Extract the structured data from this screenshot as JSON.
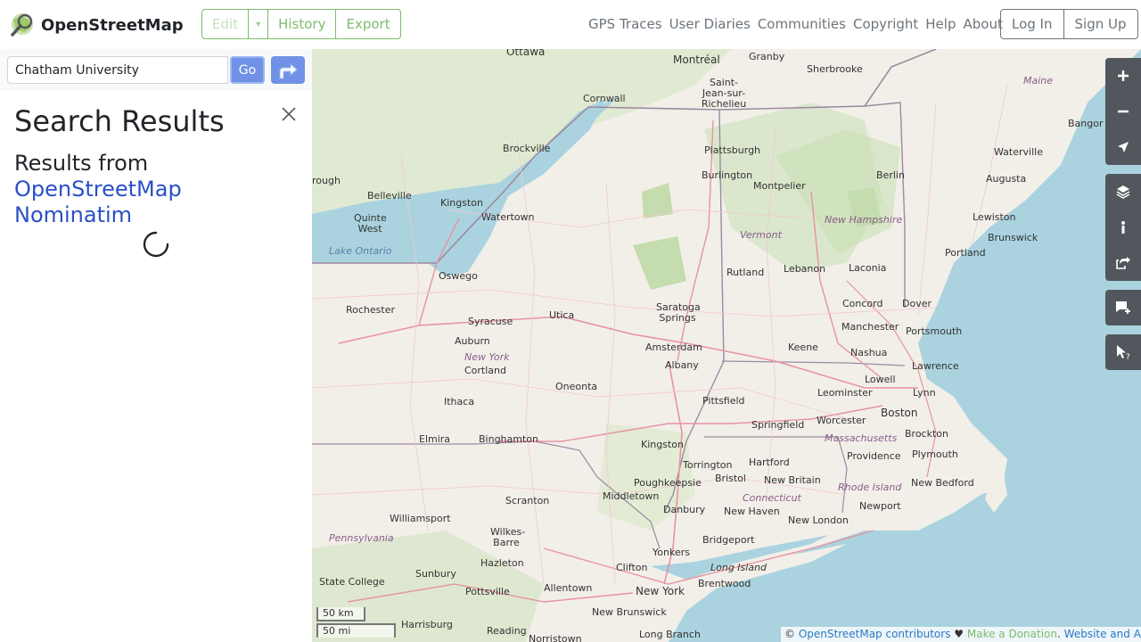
{
  "header": {
    "title": "OpenStreetMap",
    "edit": "Edit",
    "history": "History",
    "export": "Export",
    "nav": [
      "GPS Traces",
      "User Diaries",
      "Communities",
      "Copyright",
      "Help",
      "About"
    ],
    "login": "Log In",
    "signup": "Sign Up"
  },
  "search": {
    "value": "Chatham University",
    "go": "Go"
  },
  "results": {
    "title": "Search Results",
    "from": "Results from",
    "provider_line1": "OpenStreetMap",
    "provider_line2": "Nominatim"
  },
  "map": {
    "places": [
      {
        "name": "Ottawa"
      },
      {
        "name": "Montréal"
      },
      {
        "name": "Granby"
      },
      {
        "name": "Sherbrooke"
      },
      {
        "name": "Saint-Jean-sur-Richelieu"
      },
      {
        "name": "Cornwall"
      },
      {
        "name": "Maine"
      },
      {
        "name": "Bangor"
      },
      {
        "name": "Brockville"
      },
      {
        "name": "Plattsburgh"
      },
      {
        "name": "Waterville"
      },
      {
        "name": "rough"
      },
      {
        "name": "Burlington"
      },
      {
        "name": "Montpelier"
      },
      {
        "name": "Berlin"
      },
      {
        "name": "Augusta"
      },
      {
        "name": "Belleville"
      },
      {
        "name": "Kingston"
      },
      {
        "name": "Quinte West"
      },
      {
        "name": "Watertown"
      },
      {
        "name": "New Hampshire"
      },
      {
        "name": "Lewiston"
      },
      {
        "name": "Vermont"
      },
      {
        "name": "Brunswick"
      },
      {
        "name": "Lake Ontario"
      },
      {
        "name": "Portland"
      },
      {
        "name": "Oswego"
      },
      {
        "name": "Rutland"
      },
      {
        "name": "Lebanon"
      },
      {
        "name": "Laconia"
      },
      {
        "name": "Rochester"
      },
      {
        "name": "Saratoga Springs"
      },
      {
        "name": "Concord"
      },
      {
        "name": "Dover"
      },
      {
        "name": "Syracuse"
      },
      {
        "name": "Utica"
      },
      {
        "name": "Manchester"
      },
      {
        "name": "Portsmouth"
      },
      {
        "name": "Auburn"
      },
      {
        "name": "Amsterdam"
      },
      {
        "name": "Keene"
      },
      {
        "name": "Nashua"
      },
      {
        "name": "New York"
      },
      {
        "name": "Albany"
      },
      {
        "name": "Lawrence"
      },
      {
        "name": "Cortland"
      },
      {
        "name": "Lowell"
      },
      {
        "name": "Leominster"
      },
      {
        "name": "Lynn"
      },
      {
        "name": "Oneonta"
      },
      {
        "name": "Ithaca"
      },
      {
        "name": "Pittsfield"
      },
      {
        "name": "Boston"
      },
      {
        "name": "Worcester"
      },
      {
        "name": "Springfield"
      },
      {
        "name": "Elmira"
      },
      {
        "name": "Binghamton"
      },
      {
        "name": "Massachusetts"
      },
      {
        "name": "Brockton"
      },
      {
        "name": "Kingston"
      },
      {
        "name": "Plymouth"
      },
      {
        "name": "Providence"
      },
      {
        "name": "Torrington"
      },
      {
        "name": "Hartford"
      },
      {
        "name": "Bristol"
      },
      {
        "name": "New Britain"
      },
      {
        "name": "Rhode Island"
      },
      {
        "name": "Poughkeepsie"
      },
      {
        "name": "New Bedford"
      },
      {
        "name": "Middletown"
      },
      {
        "name": "Connecticut"
      },
      {
        "name": "Scranton"
      },
      {
        "name": "Danbury"
      },
      {
        "name": "Newport"
      },
      {
        "name": "Williamsport"
      },
      {
        "name": "New Haven"
      },
      {
        "name": "New London"
      },
      {
        "name": "Wilkes-Barre"
      },
      {
        "name": "Bridgeport"
      },
      {
        "name": "Pennsylvania"
      },
      {
        "name": "Hazleton"
      },
      {
        "name": "Yonkers"
      },
      {
        "name": "Long Island"
      },
      {
        "name": "Clifton"
      },
      {
        "name": "State College"
      },
      {
        "name": "Sunbury"
      },
      {
        "name": "Brentwood"
      },
      {
        "name": "Pottsville"
      },
      {
        "name": "Allentown"
      },
      {
        "name": "New York"
      },
      {
        "name": "New Brunswick"
      },
      {
        "name": "Harrisburg"
      },
      {
        "name": "Reading"
      },
      {
        "name": "Norristown"
      },
      {
        "name": "Long Branch"
      }
    ],
    "scale_km": "50 km",
    "scale_mi": "50 mi"
  },
  "attribution": {
    "prefix": "©",
    "osm": "OpenStreetMap contributors",
    "heart": "♥",
    "donate": "Make a Donation",
    "sep": ".",
    "terms": "Website and API terms"
  },
  "colors": {
    "accent": "#7ebc6f",
    "link": "#2a50c6",
    "go": "#7092e6",
    "control": "#52575d",
    "water": "#aad3df"
  }
}
